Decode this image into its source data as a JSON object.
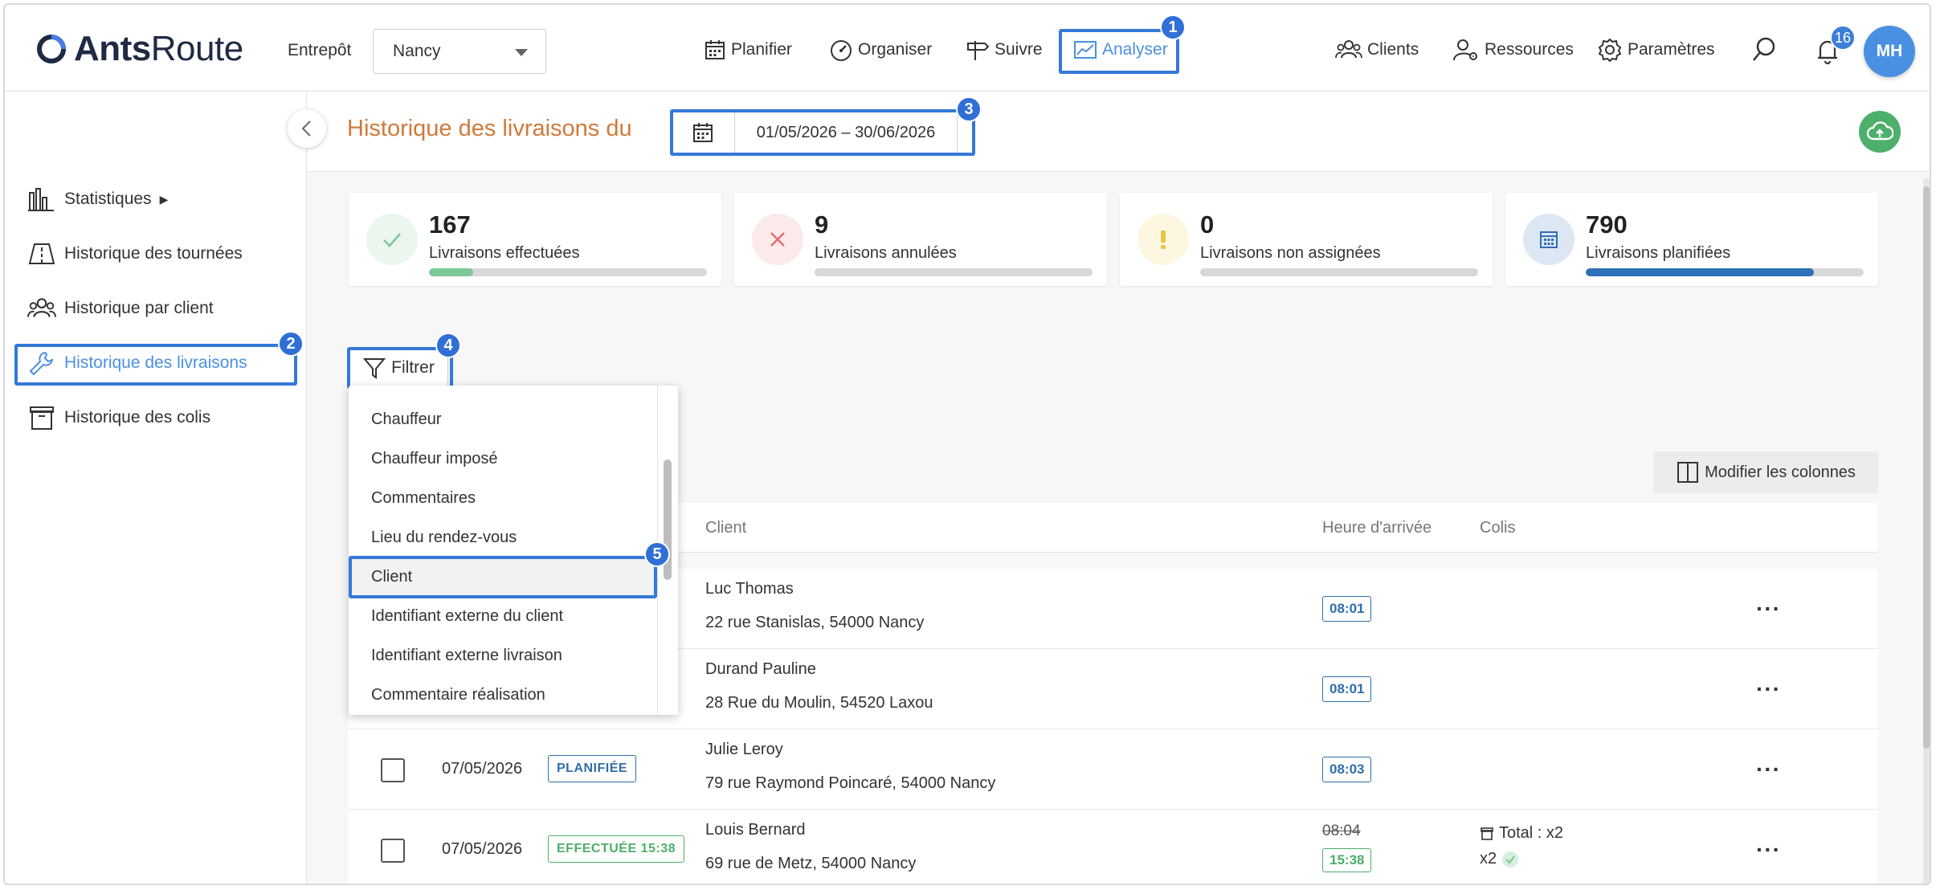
{
  "app": {
    "logo_bold": "Ants",
    "logo_regular": "Route"
  },
  "topbar": {
    "warehouse_label": "Entrepôt",
    "warehouse_value": "Nancy",
    "nav": {
      "plan": "Planifier",
      "organize": "Organiser",
      "track": "Suivre",
      "analyze": "Analyser"
    },
    "right": {
      "clients": "Clients",
      "resources": "Ressources",
      "settings": "Paramètres"
    },
    "notification_count": "16",
    "user_initials": "MH"
  },
  "sidebar": {
    "items": [
      {
        "label": "Statistiques",
        "arrow": "▶"
      },
      {
        "label": "Historique des tournées"
      },
      {
        "label": "Historique par client"
      },
      {
        "label": "Historique des livraisons"
      },
      {
        "label": "Historique des colis"
      }
    ]
  },
  "header": {
    "title": "Historique des livraisons du",
    "date_range": "01/05/2026 – 30/06/2026"
  },
  "kpis": [
    {
      "value": "167",
      "label": "Livraisons effectuées",
      "progress": 0.16,
      "color": "#7dc896"
    },
    {
      "value": "9",
      "label": "Livraisons annulées",
      "progress": 0.0,
      "color": "#e07070"
    },
    {
      "value": "0",
      "label": "Livraisons non assignées",
      "progress": 0.0,
      "color": "#e8c440"
    },
    {
      "value": "790",
      "label": "Livraisons planifiées",
      "progress": 0.82,
      "color": "#2f6fb8"
    }
  ],
  "filter": {
    "label": "Filtrer"
  },
  "dropdown": {
    "items": [
      "Chauffeur",
      "Chauffeur imposé",
      "Commentaires",
      "Lieu du rendez-vous",
      "Client",
      "Identifiant externe du client",
      "Identifiant externe livraison",
      "Commentaire réalisation"
    ]
  },
  "table": {
    "modify_columns": "Modifier les colonnes",
    "headers": {
      "client": "Client",
      "arrival": "Heure d'arrivée",
      "parcels": "Colis"
    },
    "rows": [
      {
        "date": "",
        "status": "",
        "client_name": "Luc Thomas",
        "address": "22 rue Stanislas, 54000 Nancy",
        "arrival": "08:01"
      },
      {
        "date": "",
        "status": "",
        "client_name": "Durand Pauline",
        "address": "28 Rue du Moulin, 54520 Laxou",
        "arrival": "08:01"
      },
      {
        "date": "07/05/2026",
        "status": "PLANIFIÉE",
        "client_name": "Julie Leroy",
        "address": "79 rue Raymond Poincaré, 54000 Nancy",
        "arrival": "08:03"
      },
      {
        "date": "07/05/2026",
        "status": "EFFECTUÉE 15:38",
        "client_name": "Louis Bernard",
        "address": "69 rue de Metz, 54000 Nancy",
        "arrival_planned": "08:04",
        "arrival": "15:38",
        "parcels_total": "Total : x2",
        "parcels_done": "x2"
      }
    ]
  },
  "annotations": [
    "1",
    "2",
    "3",
    "4",
    "5"
  ],
  "colors": {
    "accent": "#4a90e2",
    "highlight": "#3478d8",
    "title": "#d07a3a",
    "success": "#4caf6a"
  }
}
